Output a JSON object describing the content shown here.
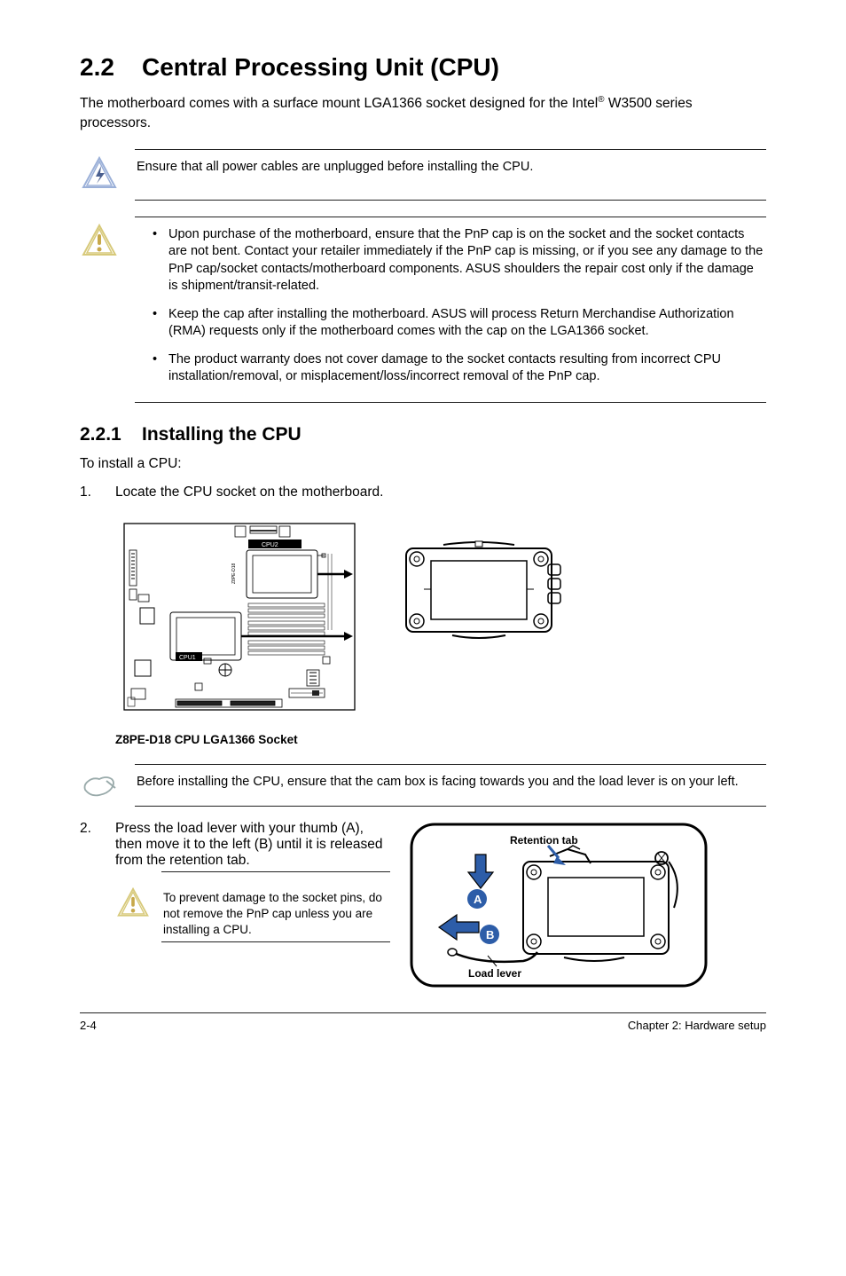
{
  "section": {
    "num": "2.2",
    "title": "Central Processing Unit (CPU)"
  },
  "intro_1": "The motherboard comes with a surface mount LGA1366 socket designed for the Intel",
  "intro_2": " W3500 series processors.",
  "danger_text": "Ensure that all power cables are unplugged before installing the CPU.",
  "warn_bullets": [
    "Upon purchase of the motherboard, ensure that the PnP cap is on the socket and the socket contacts are not bent. Contact your retailer immediately if the PnP cap is missing, or if you see any damage to the PnP cap/socket contacts/motherboard components. ASUS shoulders the repair cost only if the damage is shipment/transit-related.",
    "Keep the cap after installing the motherboard. ASUS will process Return Merchandise Authorization (RMA) requests only if the motherboard comes with the cap on the LGA1366 socket.",
    "The product warranty does not cover damage to the socket contacts resulting from incorrect CPU installation/removal, or misplacement/loss/incorrect removal of the PnP cap."
  ],
  "subsection": {
    "num": "2.2.1",
    "title": "Installing the CPU"
  },
  "lead": "To install a CPU:",
  "step1_text": "Locate the CPU socket on the motherboard.",
  "diagram_labels": {
    "cpu1": "CPU1",
    "cpu2": "CPU2",
    "board_side": "Z8PE-D18"
  },
  "caption": "Z8PE-D18 CPU LGA1366 Socket",
  "note_text": "Before installing the CPU, ensure that the cam box is facing towards you and the load lever is on your left.",
  "step2_text": "Press the load lever with your thumb (A), then move it to the left (B) until it is released from the retention tab.",
  "step2_labels": {
    "retention": "Retention tab",
    "lever": "Load lever",
    "a": "A",
    "b": "B"
  },
  "inner_warn": "To prevent damage to the socket pins, do not remove the PnP cap unless you are installing a CPU.",
  "footer": {
    "left": "2-4",
    "right": "Chapter 2:  Hardware setup"
  }
}
